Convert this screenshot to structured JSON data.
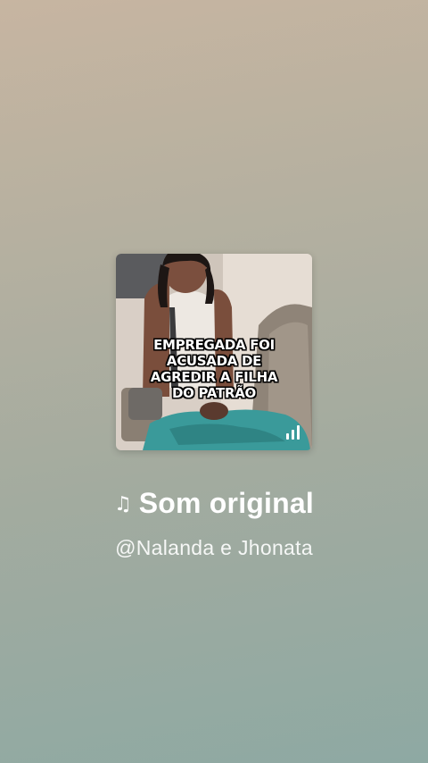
{
  "cover": {
    "caption_lines": [
      "EMPREGADA FOI",
      "ACUSADA DE",
      "AGREDIR A FILHA",
      "DO PATRÃO"
    ],
    "icon": "audio-bars-icon"
  },
  "sound": {
    "icon": "music-note-icon",
    "icon_glyph": "♫",
    "title": "Som original",
    "artist": "@Nalanda e Jhonata"
  },
  "colors": {
    "background_top": "#c7b5a1",
    "background_bottom": "#8ea9a3",
    "text": "#ffffff"
  }
}
